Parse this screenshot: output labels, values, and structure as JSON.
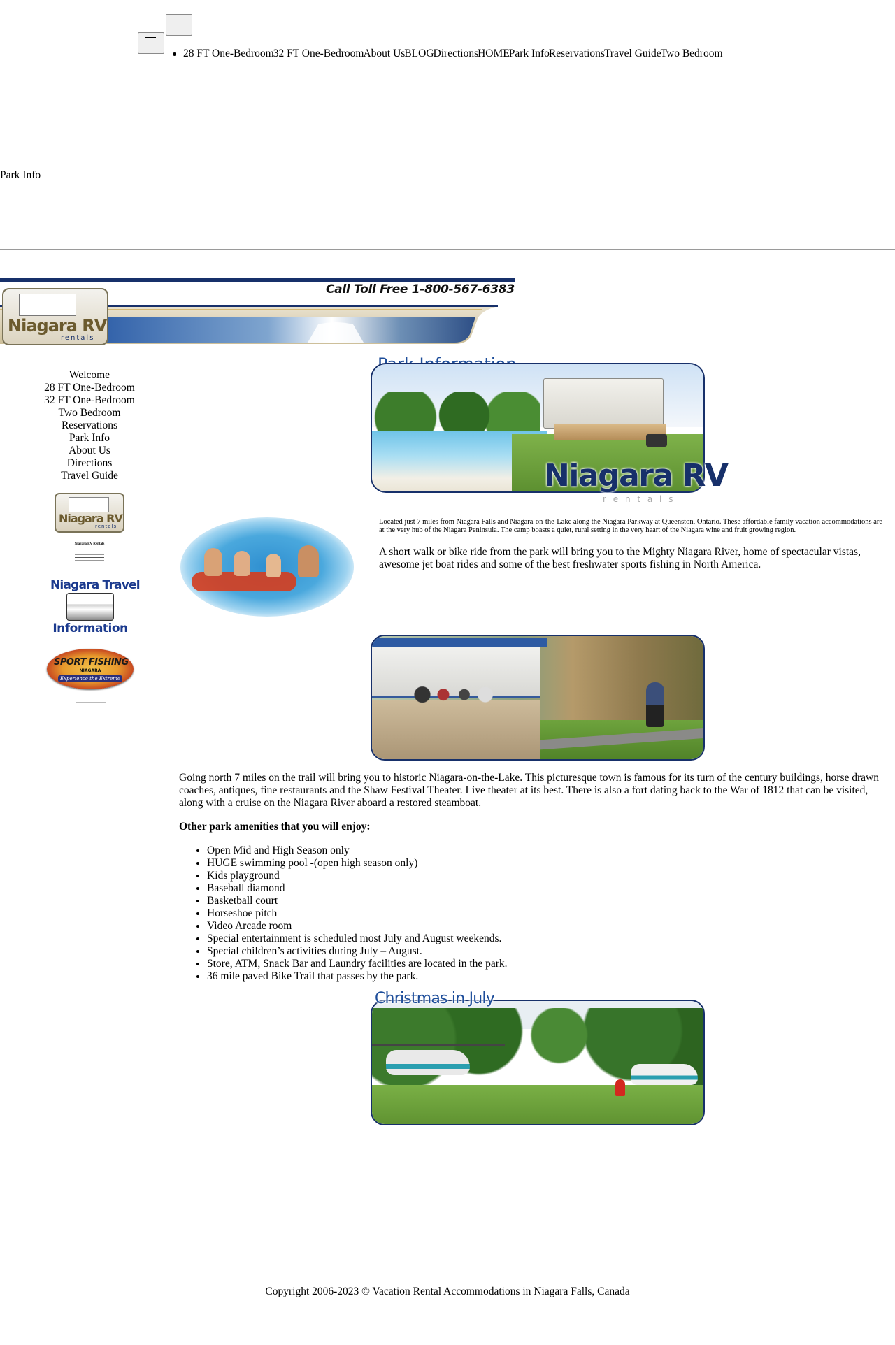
{
  "top_nav": {
    "items": [
      "28 FT One-Bedroom",
      "32 FT One-Bedroom",
      "About Us",
      "BLOG",
      "Directions",
      "HOME",
      "Park Info",
      "Reservations",
      "Travel Guide",
      "Two Bedroom"
    ]
  },
  "page_title": "Park Info",
  "banner": {
    "phone": "Call Toll Free 1-800-567-6383",
    "logo_title": "Niagara RV",
    "logo_sub": "rentals"
  },
  "left_menu": {
    "items": [
      "Welcome",
      "28 FT One-Bedroom",
      "32 FT One-Bedroom",
      "Two Bedroom",
      "Reservations",
      "Park Info",
      "About Us",
      "Directions",
      "Travel Guide"
    ]
  },
  "sidebar": {
    "logo_title": "Niagara RV",
    "logo_sub": "rentals",
    "address_title": "Niagara RV Rentals",
    "travel_logo_line1": "Niagara Travel",
    "travel_logo_line2": "Information",
    "fishing_title": "SPORT FISHING",
    "fishing_sub": "NIAGARA",
    "fishing_tag": "Experience the Extreme"
  },
  "hero": {
    "heading": "Park Information",
    "brand": "Niagara RV",
    "brand_sub": "r e n t a l s"
  },
  "intro_small": "Located just 7 miles from Niagara Falls and Niagara-on-the-Lake along the Niagara Parkway at Queenston, Ontario. These affordable family vacation accommodations are at the very hub of the Niagara Peninsula. The camp boasts a quiet, rural setting in the very heart of the Niagara wine and fruit growing region.",
  "intro_river": "A short walk or bike ride from the park will bring you to the Mighty Niagara River, home of spectacular vistas, awesome jet boat rides and some of the best freshwater sports fishing in North America.",
  "north_paragraph": "Going north 7 miles on the trail will bring you to historic Niagara-on-the-Lake. This picturesque town is famous for its turn of the century buildings, horse drawn coaches, antiques, fine restaurants and the Shaw Festival Theater. Live theater at its best. There is also a fort dating back to the War of 1812 that can be visited, along with a cruise on the Niagara River aboard a restored steamboat.",
  "amenities_heading": "Other park amenities that you will enjoy:",
  "amenities": [
    "Open Mid and High Season only",
    "HUGE swimming pool -(open high season only)",
    "Kids playground",
    "Baseball diamond",
    "Basketball court",
    "Horseshoe pitch",
    "Video Arcade room",
    "Special entertainment is scheduled most July and August weekends.",
    "Special children’s activities during July – August.",
    "Store, ATM, Snack Bar and Laundry facilities are located in the park.",
    "36 mile paved Bike Trail that passes by the park."
  ],
  "christmas": {
    "heading": "Christmas in July"
  },
  "footer": "Copyright 2006-2023 © Vacation Rental Accommodations in Niagara Falls, Canada",
  "colors": {
    "navy": "#17306a",
    "banner_gold": "#d4b774",
    "water": "#3aa0d6"
  }
}
